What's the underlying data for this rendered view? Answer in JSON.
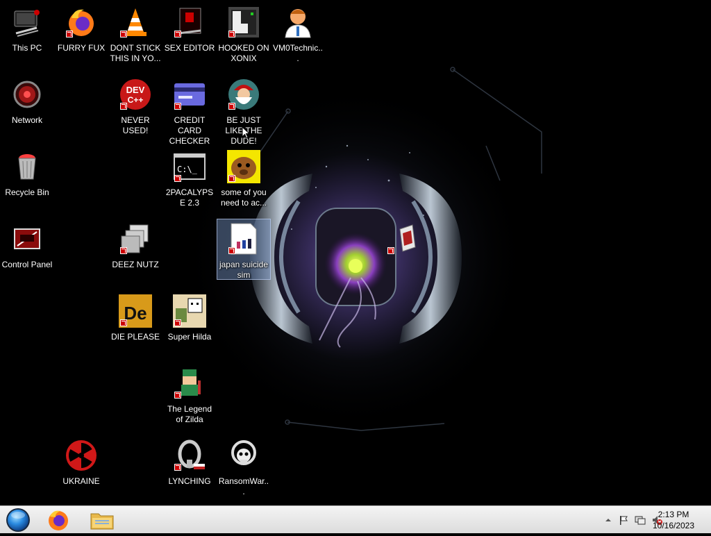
{
  "desktop": {
    "icons": [
      {
        "id": "this-pc",
        "label": "This PC",
        "icon": "computer-icon"
      },
      {
        "id": "network",
        "label": "Network",
        "icon": "network-icon"
      },
      {
        "id": "recycle-bin",
        "label": "Recycle Bin",
        "icon": "recycle-bin-icon"
      },
      {
        "id": "control-panel",
        "label": "Control Panel",
        "icon": "control-panel-icon"
      },
      {
        "id": "furry-fux",
        "label": "FURRY FUX",
        "icon": "firefox-icon"
      },
      {
        "id": "dont-stick",
        "label": "DONT STICK THIS IN YO...",
        "icon": "vlc-cone-icon"
      },
      {
        "id": "sex-editor",
        "label": "SEX EDITOR",
        "icon": "editor-icon"
      },
      {
        "id": "hooked-on-xonix",
        "label": "HOOKED ON XONIX",
        "icon": "xonix-game-icon"
      },
      {
        "id": "vm0technic",
        "label": "VM0Technic...",
        "icon": "doctor-avatar-icon"
      },
      {
        "id": "never-used",
        "label": "NEVER USED!",
        "icon": "dev-cpp-icon"
      },
      {
        "id": "credit-card-checker",
        "label": "CREDIT CARD CHECKER",
        "icon": "credit-card-icon"
      },
      {
        "id": "be-just-like-the-dude",
        "label": "BE JUST LIKE THE DUDE!",
        "icon": "santa-face-icon"
      },
      {
        "id": "2pacalypse",
        "label": "2PACALYPSE 2.3",
        "icon": "console-icon"
      },
      {
        "id": "some-of-you",
        "label": "some of you need to ac...",
        "icon": "dog-face-icon"
      },
      {
        "id": "deez-nutz",
        "label": "DEEZ NUTZ",
        "icon": "stacked-windows-icon"
      },
      {
        "id": "japan-suicide-sim",
        "label": "japan suicide sim",
        "icon": "document-figures-icon",
        "selected": true
      },
      {
        "id": "die-please",
        "label": "DIE PLEASE",
        "icon": "die-logo-icon"
      },
      {
        "id": "super-hilda",
        "label": "Super Hilda",
        "icon": "pixel-character-icon"
      },
      {
        "id": "legend-of-zilda",
        "label": "The Legend of Zilda",
        "icon": "pixel-hero-icon"
      },
      {
        "id": "ukraine",
        "label": "UKRAINE",
        "icon": "radiation-icon"
      },
      {
        "id": "lynching",
        "label": "LYNCHING",
        "icon": "noose-icon"
      },
      {
        "id": "ransomwar",
        "label": "RansomWar...",
        "icon": "skull-icon"
      },
      {
        "id": "unlabeled-file",
        "label": "",
        "icon": "document-icon"
      }
    ]
  },
  "taskbar": {
    "start_icon": "start-orb-icon",
    "pinned": [
      {
        "name": "firefox",
        "icon": "firefox-icon"
      },
      {
        "name": "file-explorer",
        "icon": "folder-icon"
      }
    ],
    "tray": {
      "icons": [
        "chevron-up-icon",
        "flag-icon",
        "network-icon",
        "volume-muted-icon"
      ],
      "time": "2:13 PM",
      "date": "10/16/2023"
    }
  },
  "colors": {
    "taskbar_bg": "#e6e6e6",
    "selection": "#7896c8",
    "wallpaper_accent": "#b39cff"
  }
}
